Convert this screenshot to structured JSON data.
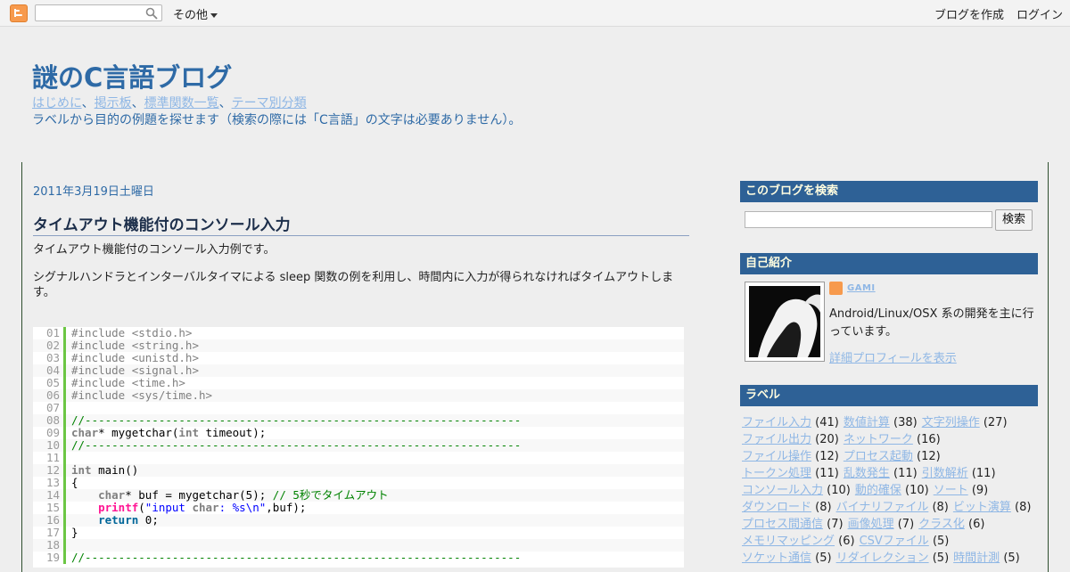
{
  "navbar": {
    "search_placeholder": "",
    "more_label": "その他",
    "create_blog_label": "ブログを作成",
    "login_label": "ログイン"
  },
  "header": {
    "title": "謎のC言語ブログ",
    "links": [
      "はじめに",
      "掲示板",
      "標準関数一覧",
      "テーマ別分類"
    ],
    "separator": "、",
    "description": "ラベルから目的の例題を探せます（検索の際には「C言語」の文字は必要ありません）。"
  },
  "post": {
    "date": "2011年3月19日土曜日",
    "title": "タイムアウト機能付のコンソール入力",
    "paragraph1": "タイムアウト機能付のコンソール入力例です。",
    "paragraph2": "シグナルハンドラとインターバルタイマによる sleep 関数の例を利用し、時間内に入力が得られなければタイムアウトします。"
  },
  "code_lines": [
    {
      "n": "01",
      "t": "#include <stdio.h>"
    },
    {
      "n": "02",
      "t": "#include <string.h>"
    },
    {
      "n": "03",
      "t": "#include <unistd.h>"
    },
    {
      "n": "04",
      "t": "#include <signal.h>"
    },
    {
      "n": "05",
      "t": "#include <time.h>"
    },
    {
      "n": "06",
      "t": "#include <sys/time.h>"
    },
    {
      "n": "07",
      "t": ""
    },
    {
      "n": "08",
      "t": "//-----------------------------------------------------------------"
    },
    {
      "n": "09",
      "t": "char* mygetchar(int timeout);"
    },
    {
      "n": "10",
      "t": "//-----------------------------------------------------------------"
    },
    {
      "n": "11",
      "t": ""
    },
    {
      "n": "12",
      "t": "int main()"
    },
    {
      "n": "13",
      "t": "{"
    },
    {
      "n": "14",
      "t": "    char* buf = mygetchar(5); // 5秒でタイムアウト"
    },
    {
      "n": "15",
      "t": "    printf(\"input char: %s\\n\",buf);"
    },
    {
      "n": "16",
      "t": "    return 0;"
    },
    {
      "n": "17",
      "t": "}"
    },
    {
      "n": "18",
      "t": ""
    },
    {
      "n": "19",
      "t": "//-----------------------------------------------------------------"
    }
  ],
  "sidebar": {
    "search_title": "このブログを検索",
    "search_button": "検索",
    "profile_title": "自己紹介",
    "profile_name": "GAMI",
    "profile_text": "Android/Linux/OSX 系の開発を主に行っています。",
    "profile_link": "詳細プロフィールを表示",
    "labels_title": "ラベル",
    "labels": [
      {
        "name": "ファイル入力",
        "count": "(41)"
      },
      {
        "name": "数値計算",
        "count": "(38)"
      },
      {
        "name": "文字列操作",
        "count": "(27)"
      },
      {
        "name": "ファイル出力",
        "count": "(20)"
      },
      {
        "name": "ネットワーク",
        "count": "(16)"
      },
      {
        "name": "ファイル操作",
        "count": "(12)"
      },
      {
        "name": "プロセス起動",
        "count": "(12)"
      },
      {
        "name": "トークン処理",
        "count": "(11)"
      },
      {
        "name": "乱数発生",
        "count": "(11)"
      },
      {
        "name": "引数解析",
        "count": "(11)"
      },
      {
        "name": "コンソール入力",
        "count": "(10)"
      },
      {
        "name": "動的確保",
        "count": "(10)"
      },
      {
        "name": "ソート",
        "count": "(9)"
      },
      {
        "name": "ダウンロード",
        "count": "(8)"
      },
      {
        "name": "バイナリファイル",
        "count": "(8)"
      },
      {
        "name": "ビット演算",
        "count": "(8)"
      },
      {
        "name": "プロセス間通信",
        "count": "(7)"
      },
      {
        "name": "画像処理",
        "count": "(7)"
      },
      {
        "name": "クラス化",
        "count": "(6)"
      },
      {
        "name": "メモリマッピング",
        "count": "(6)"
      },
      {
        "name": "CSVファイル",
        "count": "(5)"
      },
      {
        "name": "ソケット通信",
        "count": "(5)"
      },
      {
        "name": "リダイレクション",
        "count": "(5)"
      },
      {
        "name": "時間計測",
        "count": "(5)"
      }
    ]
  },
  "colors": {
    "title_blue": "#2e6aa6",
    "widget_header": "#2e6196",
    "link_light": "#8fb7e5",
    "blogger_orange": "#f79a4d"
  }
}
